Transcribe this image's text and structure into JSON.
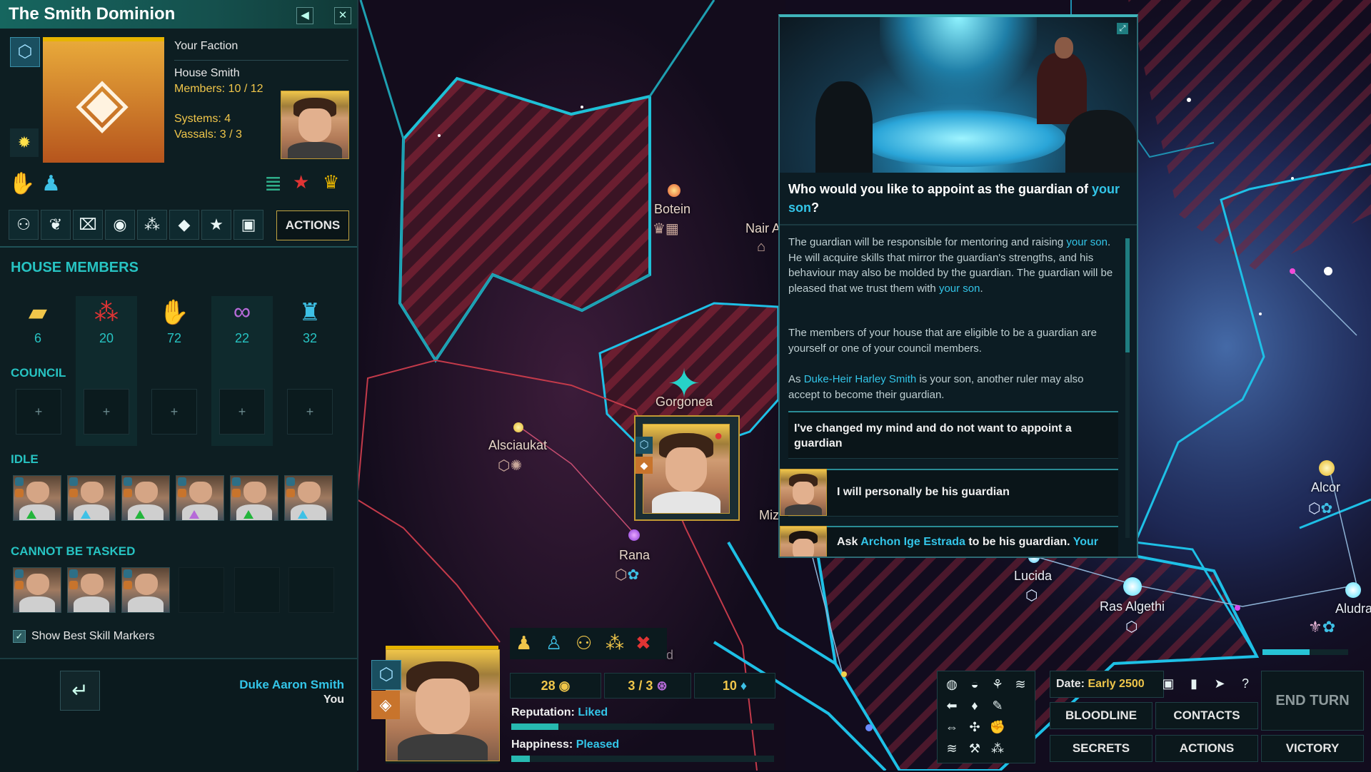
{
  "faction_panel": {
    "title": "The Smith Dominion",
    "your_faction_label": "Your Faction",
    "house_name": "House Smith",
    "members": "Members: 10 / 12",
    "systems": "Systems: 4",
    "vassals": "Vassals: 3 / 3",
    "actions_tab": "ACTIONS"
  },
  "house_members": {
    "heading": "HOUSE MEMBERS",
    "stats": [
      {
        "icon": "folder-icon",
        "value": "6"
      },
      {
        "icon": "blood-drops-icon",
        "value": "20"
      },
      {
        "icon": "handshake-icon",
        "value": "72"
      },
      {
        "icon": "chain-icon",
        "value": "22"
      },
      {
        "icon": "statue-icon",
        "value": "32"
      }
    ],
    "council_heading": "COUNCIL",
    "idle_heading": "IDLE",
    "cannot_be_tasked_heading": "CANNOT BE TASKED",
    "show_best_skill_markers": "Show Best Skill Markers"
  },
  "ruler": {
    "name": "Duke Aaron Smith",
    "subtitle": "You"
  },
  "map_labels": {
    "botein": "Botein",
    "nair": "Nair A",
    "gorgonea": "Gorgonea",
    "alsciaukat": "Alsciaukat",
    "rana": "Rana",
    "miz": "Miz",
    "lucida": "Lucida",
    "ras_algethi": "Ras Algethi",
    "alcor": "Alcor",
    "aludra": "Aludra",
    "d": "d"
  },
  "dialog": {
    "question_pre": "Who would you like to appoint as the guardian of ",
    "question_hl": "your son",
    "question_post": "?",
    "para1_a": "The guardian will be responsible for mentoring and raising ",
    "para1_b": "your son",
    "para1_c": ". He will acquire skills that mirror the guardian's strengths, and his behaviour may also be molded by the guardian. The guardian will be pleased that we trust them with ",
    "para1_d": "your son",
    "para1_e": ".",
    "para2": "The members of your house that are eligible to be a guardian are yourself or one of your council members.",
    "para3_a": "As ",
    "para3_b": "Duke-Heir Harley Smith",
    "para3_c": " is your son, another ruler may also accept to become their guardian.",
    "option1": "I've changed my mind and do not want to appoint a guardian",
    "option2": "I will personally be his guardian",
    "option3_a": "Ask ",
    "option3_b": "Archon Ige Estrada",
    "option3_c": " to be his guardian. ",
    "option3_d": "Your"
  },
  "hud": {
    "credits": "28",
    "influence": "3 / 3",
    "gems": "10",
    "reputation_label": "Reputation: ",
    "reputation_value": "Liked",
    "reputation_level": 0.18,
    "happiness_label": "Happiness: ",
    "happiness_value": "Pleased",
    "happiness_level": 0.07,
    "date_label": "Date: ",
    "date_value": "Early 2500",
    "end_turn": "END TURN",
    "help": "?",
    "buttons": {
      "bloodline": "BLOODLINE",
      "contacts": "CONTACTS",
      "secrets": "SECRETS",
      "actions": "ACTIONS",
      "victory": "VICTORY"
    },
    "turn_progress": 0.55
  },
  "colors": {
    "accent": "#27c3c2",
    "gold": "#f0c64a",
    "highlight": "#33c5e8",
    "territory_red": "#c33a4a",
    "border_cyan": "#1ec0e6"
  }
}
